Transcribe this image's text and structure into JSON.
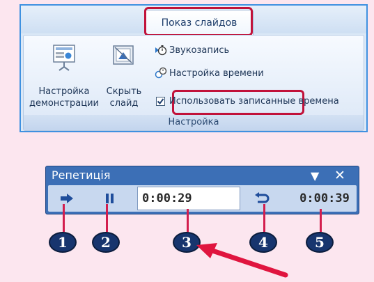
{
  "ribbon": {
    "active_tab": "Показ слайдов",
    "buttons": {
      "setup_show_line1": "Настройка",
      "setup_show_line2": "демонстрации",
      "hide_slide_line1": "Скрыть",
      "hide_slide_line2": "слайд"
    },
    "small": {
      "record_narration": "Звукозапись",
      "rehearse_timings": "Настройка времени",
      "use_timings": "Использовать записанные времена"
    },
    "group_label": "Настройка",
    "use_timings_checked": true
  },
  "rehearsal": {
    "title": "Репетиція",
    "slide_time": "0:00:29",
    "total_time": "0:00:39",
    "dropdown_icon": "triangle-down-icon",
    "close_icon": "close-icon"
  },
  "markers": [
    "1",
    "2",
    "3",
    "4",
    "5"
  ],
  "colors": {
    "background": "#fce6ef",
    "highlight": "#c1123a",
    "toolbar": "#3c6fb6",
    "marker": "#17356e",
    "arrow": "#e0153f"
  }
}
